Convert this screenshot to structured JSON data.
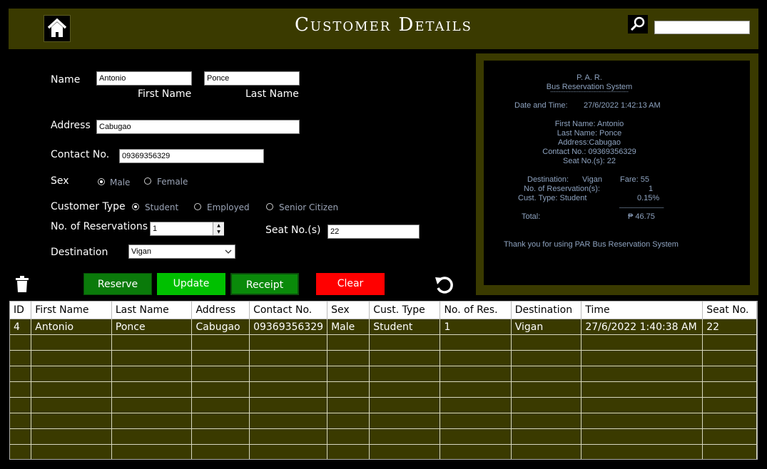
{
  "header": {
    "title": "Customer Details",
    "search_value": ""
  },
  "form": {
    "name_label": "Name",
    "first_name_value": "Antonio",
    "last_name_value": "Ponce",
    "first_name_caption": "First Name",
    "last_name_caption": "Last Name",
    "address_label": "Address",
    "address_value": "Cabugao",
    "contact_label": "Contact No.",
    "contact_value": "09369356329",
    "sex_label": "Sex",
    "sex_options": [
      "Male",
      "Female"
    ],
    "customer_type_label": "Customer Type",
    "customer_type_options": [
      "Student",
      "Employed",
      "Senior Citizen"
    ],
    "reservations_label": "No. of Reservations",
    "reservations_value": "1",
    "seat_label": "Seat No.(s)",
    "seat_value": "22",
    "destination_label": "Destination",
    "destination_value": "Vigan"
  },
  "buttons": {
    "reserve": "Reserve",
    "update": "Update",
    "receipt": "Receipt",
    "clear": "Clear"
  },
  "receipt": {
    "line1": "P. A. R.",
    "line2": "Bus Reservation System",
    "divider": "-----------------------------------------------",
    "datetime_label": "Date and Time:",
    "datetime_value": "27/6/2022 1:42:13 AM",
    "first_name": "First Name: Antonio",
    "last_name": "Last Name: Ponce",
    "address": "Address:Cabugao",
    "contact": "Contact No.: 09369356329",
    "seats": "Seat No.(s): 22",
    "destination_label": "Destination:",
    "destination_value": "Vigan",
    "fare": "Fare:  55",
    "reservations_label": "No. of Reservation(s):",
    "reservations_value": "1",
    "cust_type": "Cust. Type: Student",
    "discount": "0.15%",
    "total_rule": "______________",
    "total_label": "Total:",
    "total_value": "₱ 46.75",
    "thanks": "Thank you for using PAR Bus Reservation System"
  },
  "table": {
    "columns": [
      "ID",
      "First Name",
      "Last Name",
      "Address",
      "Contact No.",
      "Sex",
      "Cust. Type",
      "No. of Res.",
      "Destination",
      "Time",
      "Seat No."
    ],
    "rows": [
      [
        "4",
        "Antonio",
        "Ponce",
        "Cabugao",
        "09369356329",
        "Male",
        "Student",
        "1",
        "Vigan",
        "27/6/2022 1:40:38 AM",
        "22"
      ]
    ]
  }
}
